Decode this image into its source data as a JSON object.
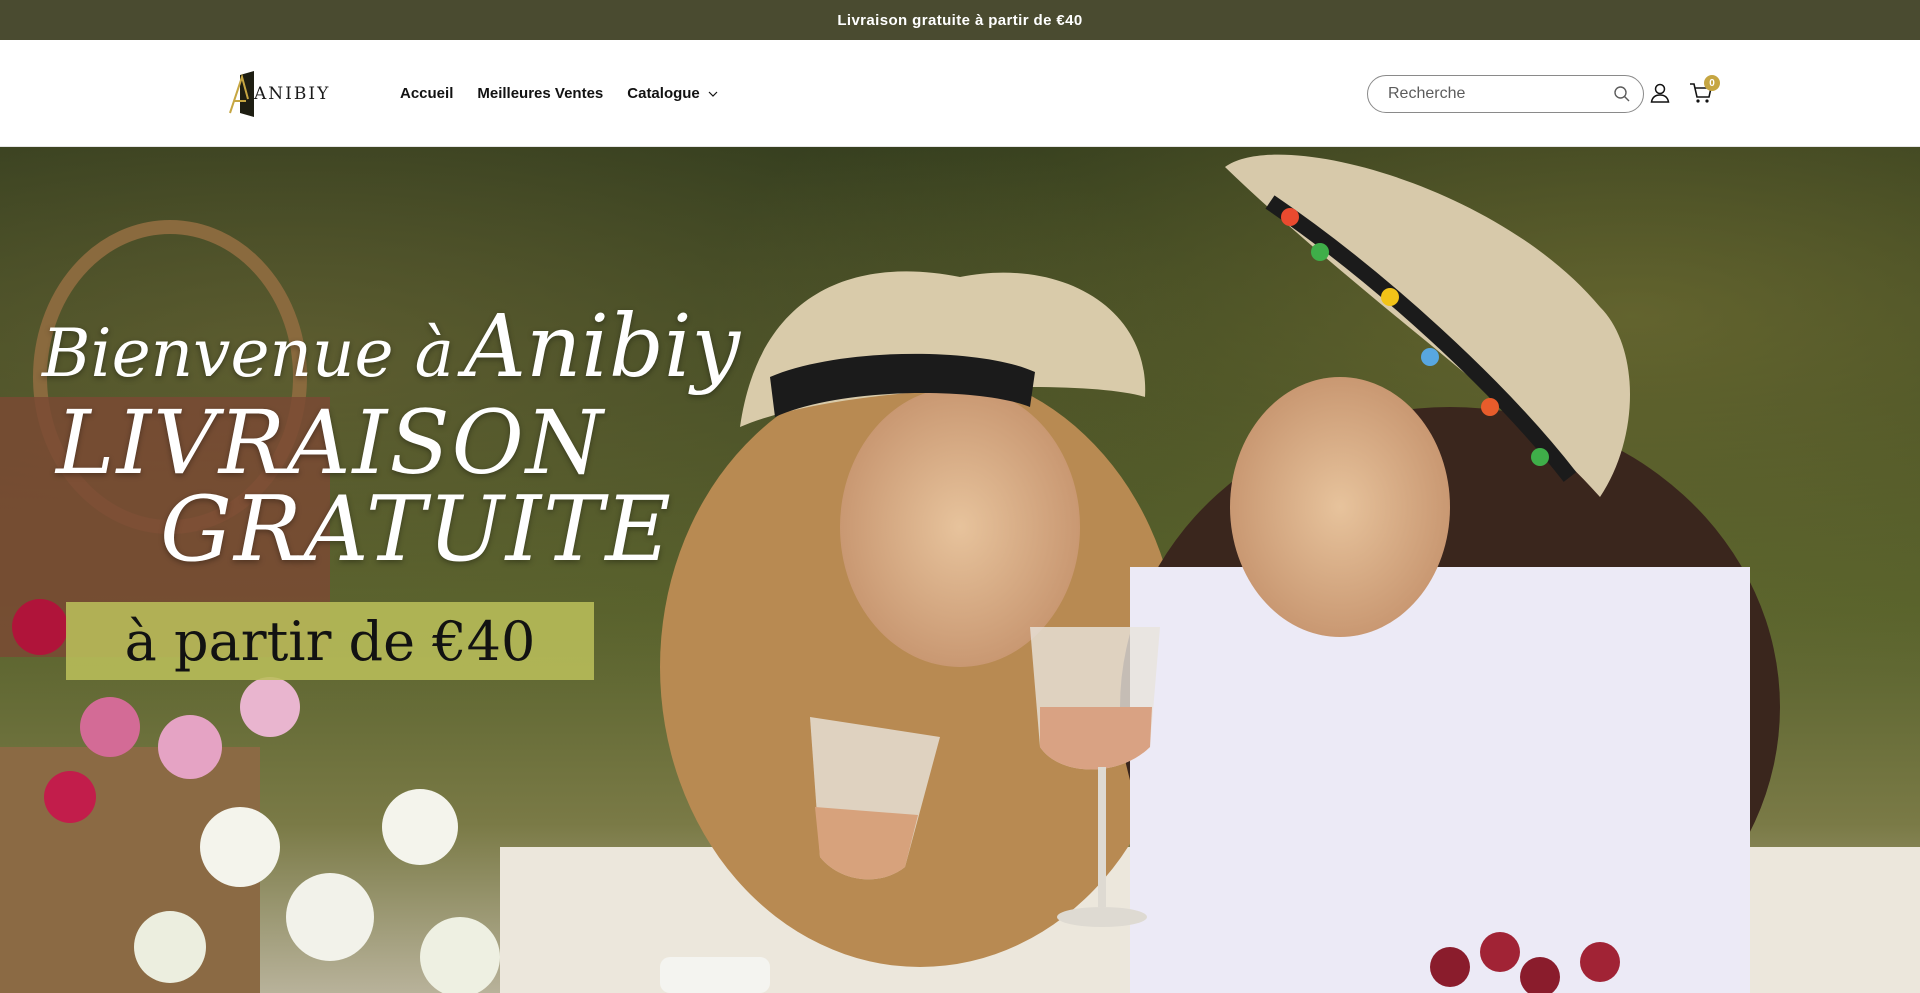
{
  "announcement": {
    "text": "Livraison gratuite à partir de €40"
  },
  "header": {
    "logo_text": "ANIBIY",
    "nav": [
      {
        "label": "Accueil"
      },
      {
        "label": "Meilleures Ventes"
      },
      {
        "label": "Catalogue",
        "has_dropdown": true
      }
    ],
    "search": {
      "placeholder": "Recherche",
      "value": ""
    },
    "icons": {
      "search": "search-icon",
      "account": "user-icon",
      "cart": "cart-icon"
    },
    "cart_count": "0"
  },
  "hero": {
    "welcome": "Bienvenue à",
    "brand": "Anibiy",
    "line1": "LIVRAISON",
    "line2": "GRATUITE",
    "box_text": "à partir de €40"
  },
  "colors": {
    "announcement_bg": "#4a4b30",
    "cart_badge": "#c6a642",
    "hero_box": "#b9be5a"
  }
}
